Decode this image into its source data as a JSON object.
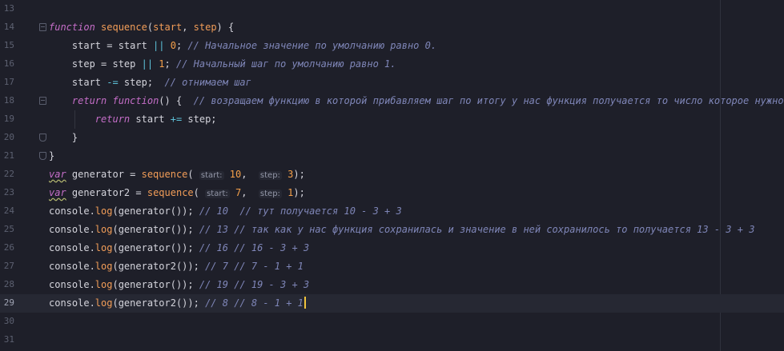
{
  "editor": {
    "current_line": 29,
    "lines": [
      {
        "n": "13"
      },
      {
        "n": "14",
        "code": [
          {
            "t": "function",
            "c": "kw"
          },
          {
            "t": " "
          },
          {
            "t": "sequence",
            "c": "fn"
          },
          {
            "t": "("
          },
          {
            "t": "start",
            "c": "pm"
          },
          {
            "t": ", "
          },
          {
            "t": "step",
            "c": "pm"
          },
          {
            "t": ") {"
          }
        ]
      },
      {
        "n": "15",
        "code": [
          {
            "t": "    start = start "
          },
          {
            "t": "||",
            "c": "op"
          },
          {
            "t": " "
          },
          {
            "t": "0",
            "c": "num"
          },
          {
            "t": "; "
          },
          {
            "t": "// Начальное значение по умолчанию равно 0.",
            "c": "cm"
          }
        ]
      },
      {
        "n": "16",
        "code": [
          {
            "t": "    step = step "
          },
          {
            "t": "||",
            "c": "op"
          },
          {
            "t": " "
          },
          {
            "t": "1",
            "c": "num"
          },
          {
            "t": "; "
          },
          {
            "t": "// Начальный шаг по умолчанию равно 1.",
            "c": "cm"
          }
        ]
      },
      {
        "n": "17",
        "code": [
          {
            "t": "    start "
          },
          {
            "t": "-=",
            "c": "op"
          },
          {
            "t": " step;  "
          },
          {
            "t": "// отнимаем шаг",
            "c": "cm"
          }
        ]
      },
      {
        "n": "18",
        "code": [
          {
            "t": "    "
          },
          {
            "t": "return",
            "c": "kw"
          },
          {
            "t": " "
          },
          {
            "t": "function",
            "c": "kw"
          },
          {
            "t": "() {  "
          },
          {
            "t": "// возращаем функцию в которой прибавляем шаг по итогу у нас функция получается то число которое нужно",
            "c": "cm"
          }
        ]
      },
      {
        "n": "19",
        "code": [
          {
            "t": "        "
          },
          {
            "t": "return",
            "c": "kw"
          },
          {
            "t": " start "
          },
          {
            "t": "+=",
            "c": "op"
          },
          {
            "t": " step;"
          }
        ]
      },
      {
        "n": "20",
        "code": [
          {
            "t": "    }"
          }
        ]
      },
      {
        "n": "21",
        "code": [
          {
            "t": "}"
          }
        ]
      },
      {
        "n": "22",
        "code": [
          {
            "t": "var",
            "c": "var"
          },
          {
            "t": " generator = "
          },
          {
            "t": "sequence",
            "c": "fn"
          },
          {
            "t": "( "
          },
          {
            "t": "start:",
            "c": "hint"
          },
          {
            "t": " "
          },
          {
            "t": "10",
            "c": "num"
          },
          {
            "t": ",  "
          },
          {
            "t": "step:",
            "c": "hint"
          },
          {
            "t": " "
          },
          {
            "t": "3",
            "c": "num"
          },
          {
            "t": ");"
          }
        ]
      },
      {
        "n": "23",
        "code": [
          {
            "t": "var",
            "c": "var"
          },
          {
            "t": " generator2 = "
          },
          {
            "t": "sequence",
            "c": "fn"
          },
          {
            "t": "( "
          },
          {
            "t": "start:",
            "c": "hint"
          },
          {
            "t": " "
          },
          {
            "t": "7",
            "c": "num"
          },
          {
            "t": ",  "
          },
          {
            "t": "step:",
            "c": "hint"
          },
          {
            "t": " "
          },
          {
            "t": "1",
            "c": "num"
          },
          {
            "t": ");"
          }
        ]
      },
      {
        "n": "24",
        "code": [
          {
            "t": "console."
          },
          {
            "t": "log",
            "c": "fn"
          },
          {
            "t": "(generator()); "
          },
          {
            "t": "// 10  // тут получается 10 - 3 + 3",
            "c": "cm"
          }
        ]
      },
      {
        "n": "25",
        "code": [
          {
            "t": "console."
          },
          {
            "t": "log",
            "c": "fn"
          },
          {
            "t": "(generator()); "
          },
          {
            "t": "// 13 // так как у нас функция сохранилась и значение в ней сохранилось то получается 13 - 3 + 3",
            "c": "cm"
          }
        ]
      },
      {
        "n": "26",
        "code": [
          {
            "t": "console."
          },
          {
            "t": "log",
            "c": "fn"
          },
          {
            "t": "(generator()); "
          },
          {
            "t": "// 16 // 16 - 3 + 3",
            "c": "cm"
          }
        ]
      },
      {
        "n": "27",
        "code": [
          {
            "t": "console."
          },
          {
            "t": "log",
            "c": "fn"
          },
          {
            "t": "(generator2()); "
          },
          {
            "t": "// 7 // 7 - 1 + 1",
            "c": "cm"
          }
        ]
      },
      {
        "n": "28",
        "code": [
          {
            "t": "console."
          },
          {
            "t": "log",
            "c": "fn"
          },
          {
            "t": "(generator()); "
          },
          {
            "t": "// 19 // 19 - 3 + 3",
            "c": "cm"
          }
        ]
      },
      {
        "n": "29",
        "code": [
          {
            "t": "console."
          },
          {
            "t": "log",
            "c": "fn"
          },
          {
            "t": "(generator2()); "
          },
          {
            "t": "// 8 // 8 - 1 + 1",
            "c": "cm"
          }
        ]
      },
      {
        "n": "30"
      },
      {
        "n": "31"
      }
    ]
  }
}
